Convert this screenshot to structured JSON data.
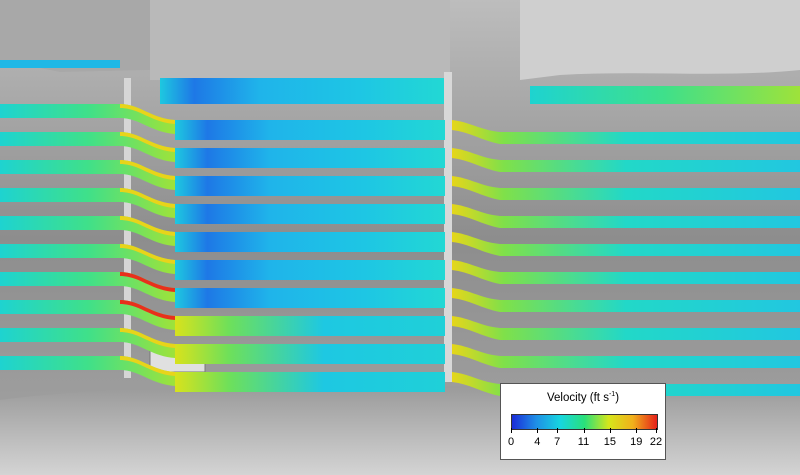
{
  "legend": {
    "title_prefix": "Velocity (ft s",
    "title_exponent": "-1",
    "title_suffix": ")",
    "ticks": [
      "0",
      "4",
      "7",
      "11",
      "15",
      "19",
      "22"
    ],
    "min_value": 0,
    "max_value": 22,
    "colors": [
      "#1a2cd8",
      "#1f8fe6",
      "#17d6e0",
      "#29e07a",
      "#d6e61b",
      "#f1b01b",
      "#e5201a"
    ]
  },
  "flow_bands": [
    {
      "velocity_reach": "low"
    },
    {
      "velocity_reach": "low"
    },
    {
      "velocity_reach": "low"
    },
    {
      "velocity_reach": "low"
    },
    {
      "velocity_reach": "low"
    },
    {
      "velocity_reach": "low"
    },
    {
      "velocity_reach": "low"
    },
    {
      "velocity_reach": "moderate"
    },
    {
      "velocity_reach": "moderate"
    },
    {
      "velocity_reach": "moderate"
    }
  ]
}
